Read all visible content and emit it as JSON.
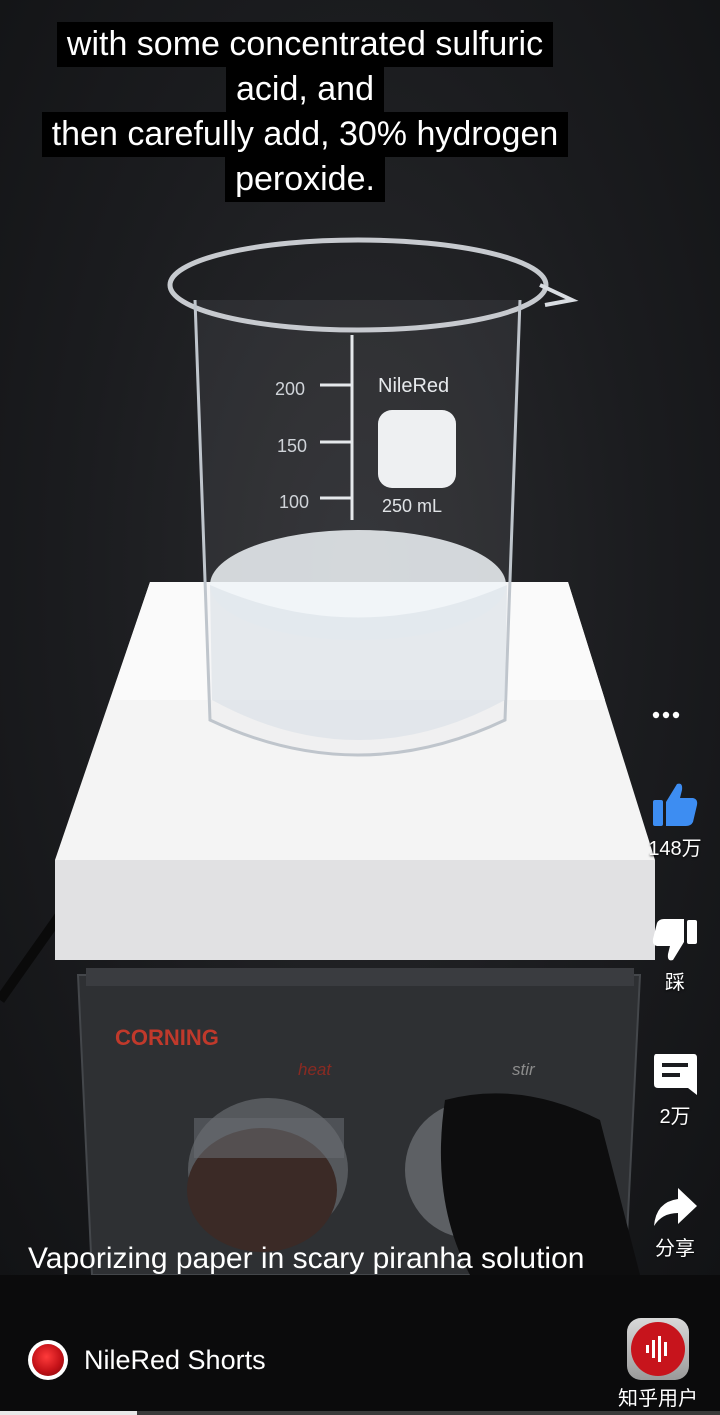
{
  "caption": {
    "lines": [
      "with some concentrated sulfuric",
      "acid, and",
      "then carefully add, 30% hydrogen",
      "peroxide."
    ]
  },
  "beaker": {
    "brand": "NileRed",
    "volume": "250 mL",
    "marks": [
      "200",
      "150",
      "100"
    ]
  },
  "hotplate": {
    "brand": "CORNING",
    "knob_left": "heat",
    "knob_right": "stir"
  },
  "actions": {
    "more_icon": "more-dots-icon",
    "like_count": "148万",
    "dislike_label": "踩",
    "comment_count": "2万",
    "share_label": "分享"
  },
  "video": {
    "title": "Vaporizing paper in scary piranha solution",
    "channel": "NileRed Shorts",
    "progress": 0.19
  },
  "zhihu": {
    "label": "知乎用户"
  },
  "colors": {
    "like_blue": "#3d8df2",
    "brand_red": "#c7141c",
    "background": "#1b1c1f"
  }
}
